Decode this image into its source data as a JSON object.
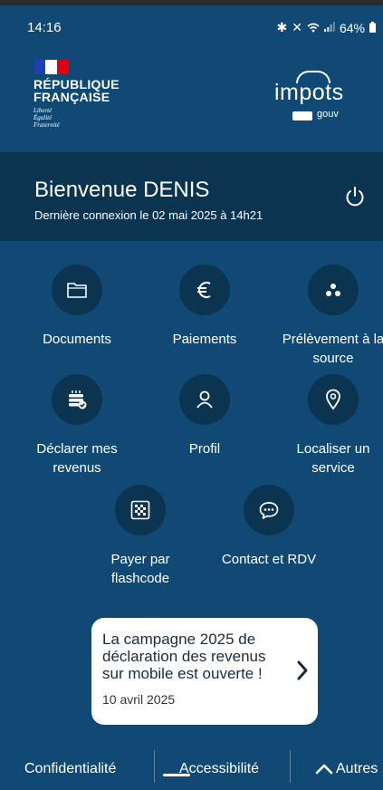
{
  "status": {
    "time": "14:16",
    "battery": "64%",
    "icons": [
      "bluetooth-icon",
      "mute-icon",
      "wifi-icon",
      "signal-icon",
      "battery-icon"
    ]
  },
  "header": {
    "republique": "RÉPUBLIQUE",
    "francaise": "FRANÇAISE",
    "motto": [
      "Liberté",
      "Égalité",
      "Fraternité"
    ],
    "logo_word": "impots",
    "logo_sub": "gouv"
  },
  "welcome": {
    "title": "Bienvenue DENIS",
    "last_login": "Dernière connexion le 02 mai 2025 à 14h21"
  },
  "tiles": [
    {
      "label": "Documents",
      "icon": "folder-icon"
    },
    {
      "label": "Paiements",
      "icon": "euro-icon"
    },
    {
      "label": "Prélèvement à la source",
      "icon": "dots-icon"
    },
    {
      "label": "Déclarer mes revenus",
      "icon": "declaration-icon"
    },
    {
      "label": "Profil",
      "icon": "user-icon"
    },
    {
      "label": "Localiser un service",
      "icon": "location-pin-icon"
    },
    {
      "label": "Payer par flashcode",
      "icon": "qr-code-icon"
    },
    {
      "label": "Contact et RDV",
      "icon": "chat-icon"
    }
  ],
  "banner": {
    "message": "La campagne 2025 de déclaration des revenus sur mobile est ouverte !",
    "date": "10 avril 2025"
  },
  "footer": {
    "privacy": "Confidentialité",
    "accessibility": "Accessibilité",
    "others": "Autres"
  },
  "colors": {
    "background": "#104a74",
    "welcome_band": "#0b3450",
    "tile_circle": "#0b3450",
    "card": "#ffffff"
  }
}
